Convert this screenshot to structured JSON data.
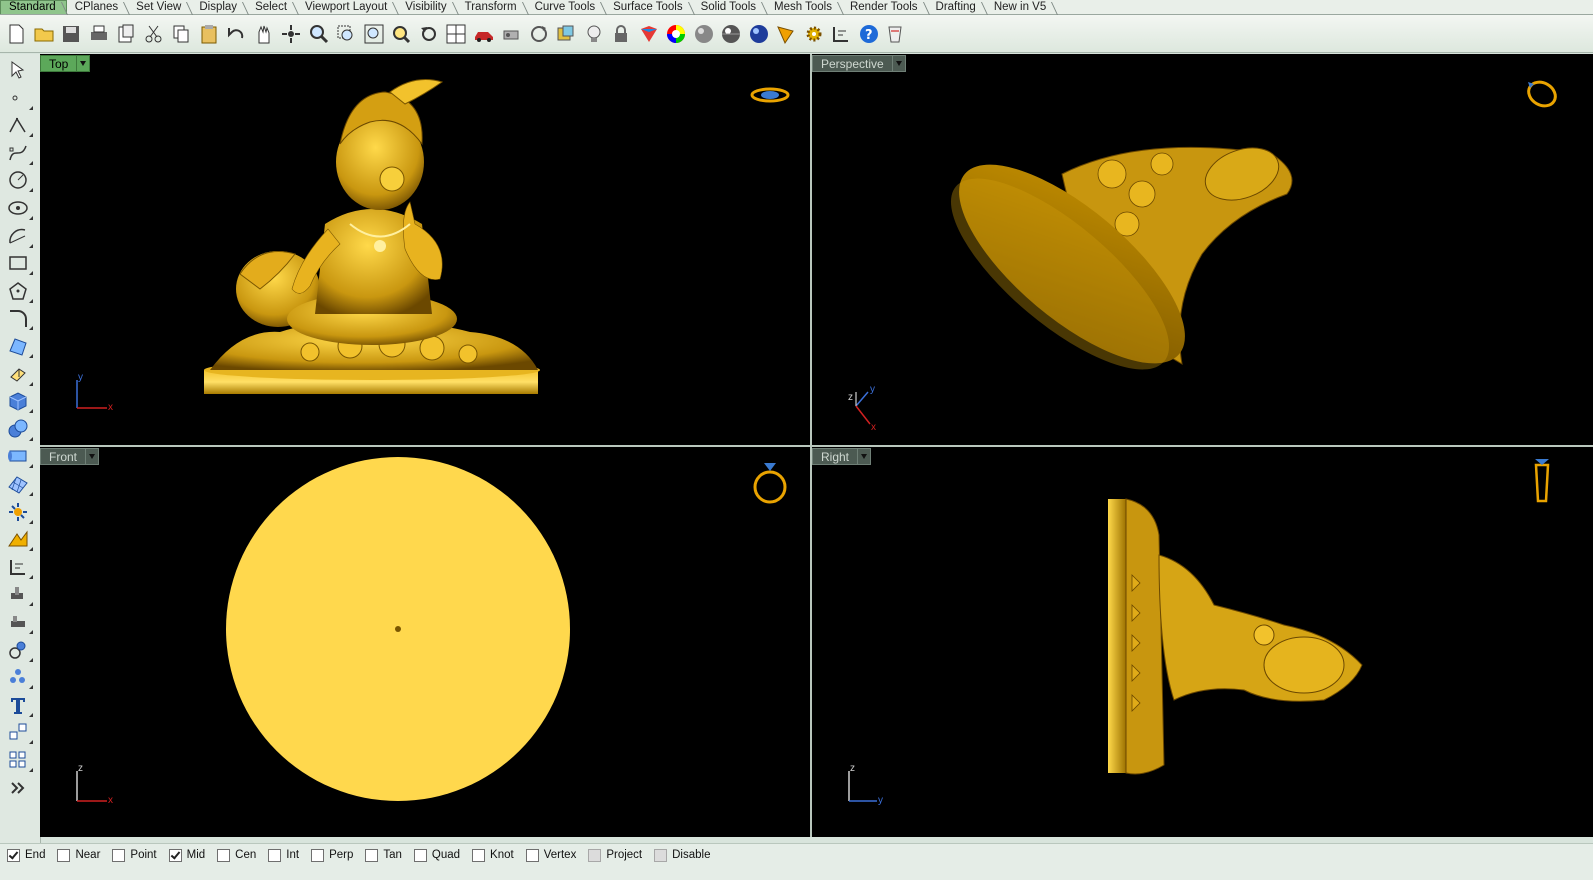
{
  "tabs": [
    {
      "label": "Standard",
      "active": true
    },
    {
      "label": "CPlanes"
    },
    {
      "label": "Set View"
    },
    {
      "label": "Display"
    },
    {
      "label": "Select"
    },
    {
      "label": "Viewport Layout"
    },
    {
      "label": "Visibility"
    },
    {
      "label": "Transform"
    },
    {
      "label": "Curve Tools"
    },
    {
      "label": "Surface Tools"
    },
    {
      "label": "Solid Tools"
    },
    {
      "label": "Mesh Tools"
    },
    {
      "label": "Render Tools"
    },
    {
      "label": "Drafting"
    },
    {
      "label": "New in V5"
    }
  ],
  "toolbar": {
    "icons": [
      "new-file-icon",
      "open-folder-icon",
      "save-icon",
      "print-icon",
      "paste-special-icon",
      "cut-icon",
      "copy-icon",
      "paste-icon",
      "undo-icon",
      "pan-hand-icon",
      "rotate-view-icon",
      "zoom-dynamic-icon",
      "zoom-window-icon",
      "zoom-extents-icon",
      "zoom-selected-icon",
      "undo-view-icon",
      "four-viewports-icon",
      "car-icon",
      "options-icon",
      "rotate-icon",
      "layer-icon",
      "light-bulb-icon",
      "lock-icon",
      "material-icon",
      "color-wheel-icon",
      "shaded-sphere-icon",
      "rendered-sphere-icon",
      "render-icon",
      "analysis-icon",
      "gear-icon",
      "dimension-icon",
      "help-icon",
      "mug-icon"
    ]
  },
  "left_toolbar": {
    "icons": [
      "select-arrow-icon",
      "point-icon",
      "polyline-icon",
      "curve-icon",
      "circle-icon",
      "ellipse-icon",
      "arc-icon",
      "rectangle-icon",
      "polygon-icon",
      "fillet-icon",
      "surface-icon",
      "extrude-icon",
      "box-icon",
      "boolean-icon",
      "pipe-icon",
      "mesh-icon",
      "explode-icon",
      "transform-icon",
      "dimension-icon",
      "solid-tools-icon",
      "group-icon",
      "curve-analysis-icon",
      "network-curve-icon",
      "text-icon",
      "block-icon",
      "array-icon",
      "more-icon"
    ]
  },
  "viewports": {
    "top": {
      "label": "Top",
      "active": true,
      "axis_v": "y",
      "axis_h": "x"
    },
    "perspective": {
      "label": "Perspective",
      "active": false,
      "axis_a": "z",
      "axis_b": "y",
      "axis_c": "x"
    },
    "front": {
      "label": "Front",
      "active": false,
      "axis_v": "z",
      "axis_h": "x"
    },
    "right": {
      "label": "Right",
      "active": false,
      "axis_v": "z",
      "axis_h": "y"
    }
  },
  "osnaps": [
    {
      "label": "End",
      "checked": true
    },
    {
      "label": "Near",
      "checked": false
    },
    {
      "label": "Point",
      "checked": false
    },
    {
      "label": "Mid",
      "checked": true
    },
    {
      "label": "Cen",
      "checked": false
    },
    {
      "label": "Int",
      "checked": false
    },
    {
      "label": "Perp",
      "checked": false
    },
    {
      "label": "Tan",
      "checked": false
    },
    {
      "label": "Quad",
      "checked": false
    },
    {
      "label": "Knot",
      "checked": false
    },
    {
      "label": "Vertex",
      "checked": false
    },
    {
      "label": "Project",
      "checked": false,
      "disabled": true
    },
    {
      "label": "Disable",
      "checked": false,
      "disabled": true
    }
  ],
  "colors": {
    "gold": "#d8a915",
    "gold_dark": "#7a5600",
    "gold_light": "#ffd84a",
    "front_disk": "#ffd84d",
    "active_tab": "#8fc58c",
    "active_viewport_label": "#5ca85a",
    "axis_x": "#d02020",
    "axis_y": "#3b6fd8"
  }
}
